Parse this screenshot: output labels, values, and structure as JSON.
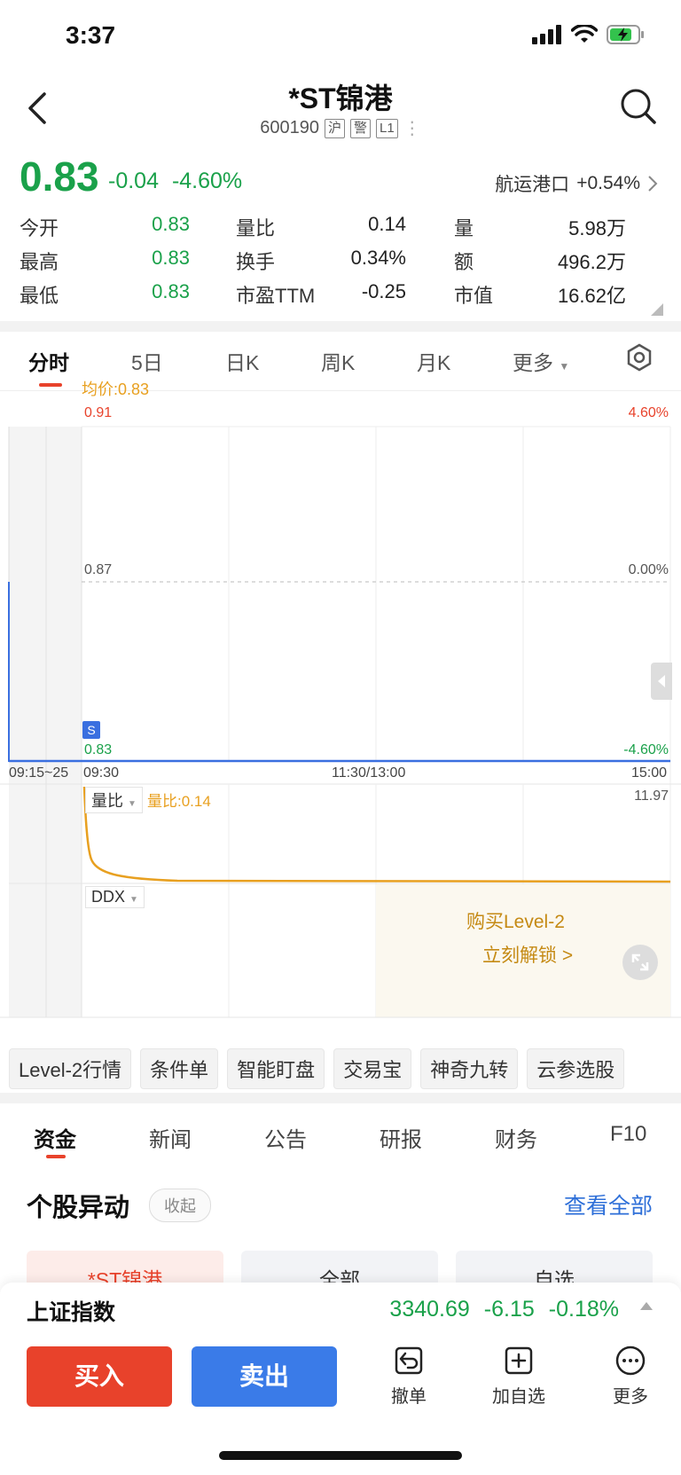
{
  "status_bar": {
    "time": "3:37"
  },
  "header": {
    "title": "*ST锦港",
    "code": "600190",
    "tags": [
      "沪",
      "警",
      "L1"
    ]
  },
  "quote": {
    "price": "0.83",
    "change": "-0.04",
    "change_pct": "-4.60%",
    "sector_name": "航运港口",
    "sector_change": "+0.54%"
  },
  "stats": {
    "open_label": "今开",
    "open": "0.83",
    "high_label": "最高",
    "high": "0.83",
    "low_label": "最低",
    "low": "0.83",
    "vol_ratio_label": "量比",
    "vol_ratio": "0.14",
    "turnover_label": "换手",
    "turnover": "0.34%",
    "pe_label": "市盈TTM",
    "pe": "-0.25",
    "volume_label": "量",
    "volume": "5.98万",
    "amount_label": "额",
    "amount": "496.2万",
    "mktcap_label": "市值",
    "mktcap": "16.62亿"
  },
  "chart_tabs": [
    "分时",
    "5日",
    "日K",
    "周K",
    "月K",
    "更多"
  ],
  "chart": {
    "avg_label": "均价:0.83",
    "price_top": "0.91",
    "price_mid": "0.87",
    "price_bottom": "0.83",
    "pct_top": "4.60%",
    "pct_mid": "0.00%",
    "pct_bottom": "-4.60%",
    "time_labels": [
      "09:15~25",
      "09:30",
      "11:30/13:00",
      "15:00"
    ],
    "s_marker": "S",
    "vr_selector": "量比",
    "vr_value": "量比:0.14",
    "vr_max": "11.97",
    "ddx_selector": "DDX",
    "level2_title": "购买Level-2",
    "level2_link": "立刻解锁 >",
    "colors": {
      "up": "#e8422b",
      "down": "#1aa14a",
      "price_line": "#3a6fe0",
      "avg_line": "#e8a020"
    }
  },
  "tool_chips": [
    "Level-2行情",
    "条件单",
    "智能盯盘",
    "交易宝",
    "神奇九转",
    "云参选股"
  ],
  "info_tabs": [
    "资金",
    "新闻",
    "公告",
    "研报",
    "财务",
    "F10"
  ],
  "section": {
    "title": "个股异动",
    "collapse": "收起",
    "see_all": "查看全部",
    "filters": [
      "*ST锦港",
      "全部",
      "自选"
    ]
  },
  "bottom": {
    "index_name": "上证指数",
    "index_value": "3340.69",
    "index_change": "-6.15",
    "index_pct": "-0.18%",
    "buy": "买入",
    "sell": "卖出",
    "cancel": "撤单",
    "add_watch": "加自选",
    "more": "更多"
  }
}
